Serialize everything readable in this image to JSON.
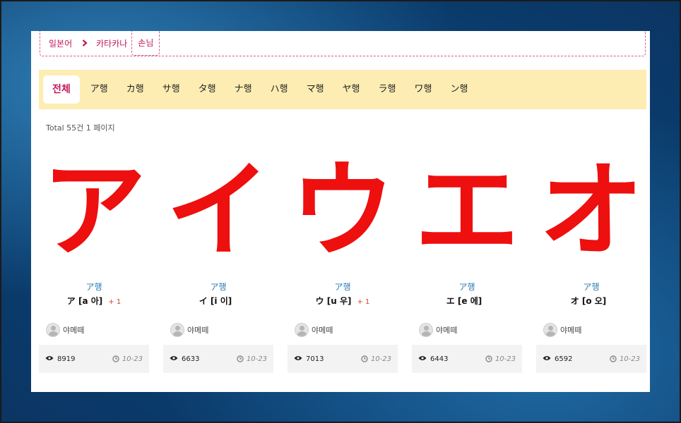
{
  "breadcrumb": {
    "items": [
      "일본어",
      "카타카나"
    ],
    "current": "손님"
  },
  "tabs": [
    "전체",
    "ア행",
    "カ행",
    "サ행",
    "タ행",
    "ナ행",
    "ハ행",
    "マ행",
    "ヤ행",
    "ラ행",
    "ワ행",
    "ン행"
  ],
  "active_tab": "전체",
  "total": "Total 55건 1 페이지",
  "cards": [
    {
      "glyph": "ア",
      "row": "ア행",
      "reading": "ア [a 아]",
      "plus": "+ 1",
      "author": "야메떼",
      "views": "8919",
      "date": "10-23"
    },
    {
      "glyph": "イ",
      "row": "ア행",
      "reading": "イ [i 이]",
      "plus": "",
      "author": "야메떼",
      "views": "6633",
      "date": "10-23"
    },
    {
      "glyph": "ウ",
      "row": "ア행",
      "reading": "ウ [u 우]",
      "plus": "+ 1",
      "author": "야메떼",
      "views": "7013",
      "date": "10-23"
    },
    {
      "glyph": "エ",
      "row": "ア행",
      "reading": "エ [e 에]",
      "plus": "",
      "author": "야메떼",
      "views": "6443",
      "date": "10-23"
    },
    {
      "glyph": "オ",
      "row": "ア행",
      "reading": "オ [o 오]",
      "plus": "",
      "author": "야메떼",
      "views": "6592",
      "date": "10-23"
    }
  ],
  "colors": {
    "accent": "#c2185b",
    "tabbar_bg": "#fdedb3",
    "glyph": "#ee0f0f",
    "row_label": "#2a7ab5"
  },
  "icons": [
    "chevron-right-icon",
    "avatar-icon",
    "eye-icon",
    "clock-icon"
  ]
}
